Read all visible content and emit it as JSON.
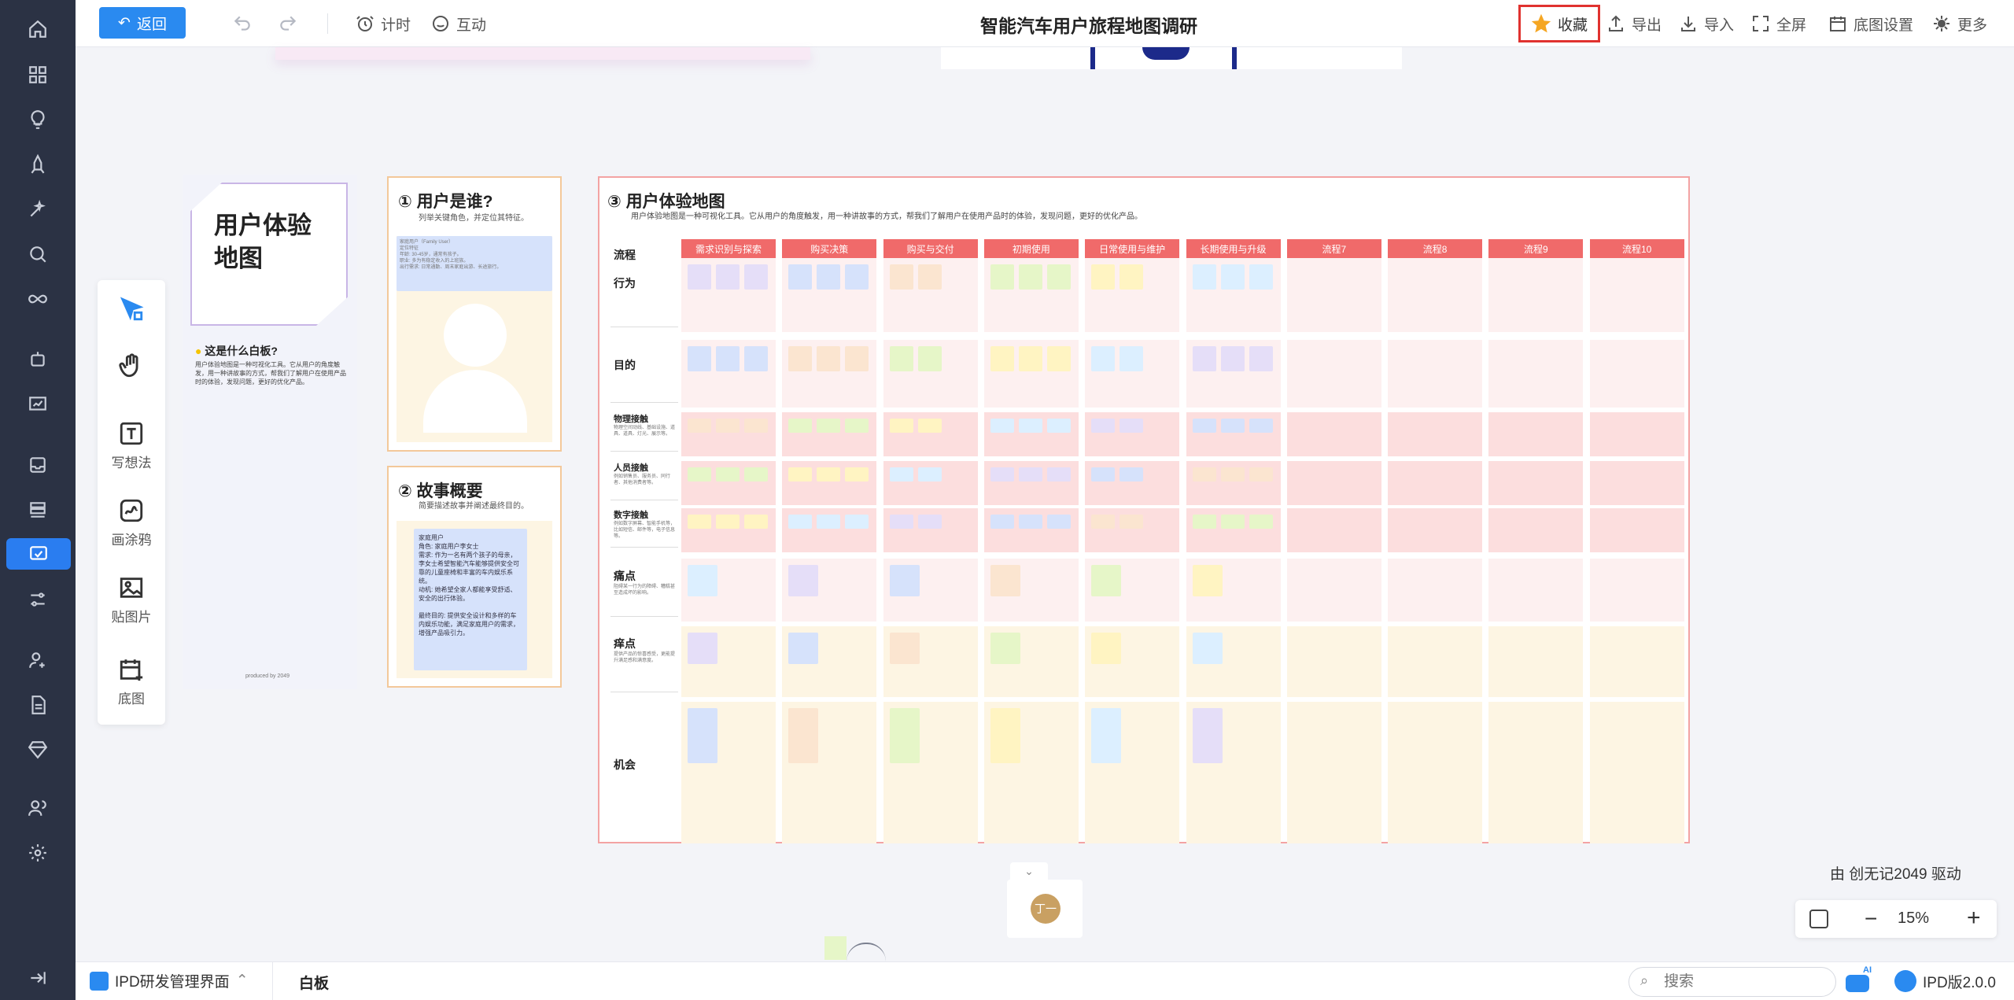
{
  "toolbar": {
    "back_label": "返回",
    "timer_label": "计时",
    "interact_label": "互动",
    "title": "智能汽车用户旅程地图调研",
    "favorite_label": "收藏",
    "export_label": "导出",
    "import_label": "导入",
    "fullscreen_label": "全屏",
    "bg_settings_label": "底图设置",
    "more_label": "更多"
  },
  "tools": {
    "write_label": "写想法",
    "doodle_label": "画涂鸦",
    "image_label": "贴图片",
    "bg_label": "底图"
  },
  "intro": {
    "card_title": "用户体验地图",
    "what_title": "这是什么白板?",
    "what_desc": "用户体验地图是一种可视化工具。它从用户的角度触发，用一种讲故事的方式，帮我们了解用户在使用产品时的体验，发现问题，更好的优化产品。",
    "footer": "produced by 2049"
  },
  "section1": {
    "title": "① 用户是谁?",
    "subtitle": "列举关键角色，并定位其特征。",
    "note_text": "家庭用户（Family User）\n定位特征\n年龄: 30-45岁，通常有孩子。\n职业: 多为有稳定收入的上班族。\n出行需求: 日常通勤、周末家庭出游、长途旅行。"
  },
  "section2": {
    "title": "② 故事概要",
    "subtitle": "简要描述故事并阐述最终目的。",
    "note_text": "家庭用户\n角色: 家庭用户李女士\n需求: 作为一名有两个孩子的母亲，李女士希望智能汽车能够提供安全可靠的儿童座椅和丰富的车内娱乐系统。\n动机: 她希望全家人都能享受舒适、安全的出行体验。\n\n最终目的: 提供安全设计和多样的车内娱乐功能，满足家庭用户的需求，增强产品吸引力。"
  },
  "section3": {
    "title": "③ 用户体验地图",
    "subtitle": "用户体验地图是一种可视化工具。它从用户的角度触发，用一种讲故事的方式，帮我们了解用户在使用产品时的体验，发现问题，更好的优化产品。",
    "flow_label": "流程",
    "stages": [
      "需求识别与探索",
      "购买决策",
      "购买与交付",
      "初期使用",
      "日常使用与维护",
      "长期使用与升级",
      "流程7",
      "流程8",
      "流程9",
      "流程10"
    ],
    "rows": [
      {
        "label": "行为",
        "desc": ""
      },
      {
        "label": "目的",
        "desc": ""
      },
      {
        "label": "物理接触",
        "desc": "物理空间动线、基础设施、道具、道具、灯光、展示等。"
      },
      {
        "label": "人员接触",
        "desc": "例如销售员、服务员、同行者、其他消费者等。"
      },
      {
        "label": "数字接触",
        "desc": "例如数字屏幕、智能手机等，比如短信、邮件等，电子信息等。"
      },
      {
        "label": "痛点",
        "desc": "阻碍某一行为的障碍、糟糕甚至造成坏的影响。"
      },
      {
        "label": "痒点",
        "desc": "提供产品的惊喜感受，更能提升满足感和满意度。"
      },
      {
        "label": "机会",
        "desc": ""
      }
    ]
  },
  "canvas": {
    "avatar_label": "丁一",
    "powered_by": "由 创无记2049 驱动"
  },
  "zoom": {
    "level": "15%"
  },
  "bottom": {
    "project_label": "IPD研发管理界面",
    "board_label": "白板",
    "search_placeholder": "搜索",
    "ai_label": "AI",
    "version_label": "IPD版2.0.0"
  },
  "colors": {
    "accent": "#2a8af0",
    "sidebar": "#2b3244",
    "stage_header": "#f06a6a",
    "favorite_border": "#e0322f",
    "star": "#f5a623"
  }
}
